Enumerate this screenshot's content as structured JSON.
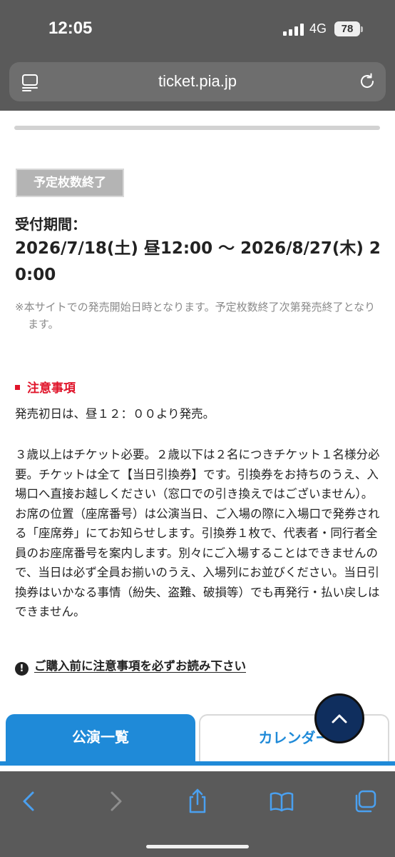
{
  "status_bar": {
    "time": "12:05",
    "network": "4G",
    "battery": "78"
  },
  "browser": {
    "url": "ticket.pia.jp"
  },
  "ticket": {
    "status_badge": "予定枚数終了",
    "period_label": "受付期間：",
    "period_value": "2026/7/18(土) 昼12:00 〜 2026/8/27(木) 20:00",
    "period_note": "※本サイトでの発売開始日時となります。予定枚数終了次第発売終了となります。"
  },
  "caution": {
    "heading": "注意事項",
    "paragraph1": "発売初日は、昼１２：００より発売。",
    "paragraph2": "３歳以上はチケット必要。２歳以下は２名につきチケット１名様分必要。チケットは全て【当日引換券】です。引換券をお持ちのうえ、入場口へ直接お越しください（窓口での引き換えではございません）。お席の位置（座席番号）は公演当日、ご入場の際に入場口で発券される「座席券」にてお知らせします。引換券１枚で、代表者・同行者全員のお座席番号を案内します。別々にご入場することはできませんので、当日は必ず全員お揃いのうえ、入場列にお並びください。当日引換券はいかなる事情（紛失、盗難、破損等）でも再発行・払い戻しはできません。",
    "notice_link": "ご購入前に注意事項を必ずお読み下さい",
    "notice_icon_glyph": "!"
  },
  "tabs": {
    "list": "公演一覧",
    "calendar": "カレンダー"
  },
  "colors": {
    "accent": "#1f8ad8",
    "caution": "#e0142a",
    "scroll_button": "#0f2e5e",
    "chrome": "#5a5a5a"
  }
}
